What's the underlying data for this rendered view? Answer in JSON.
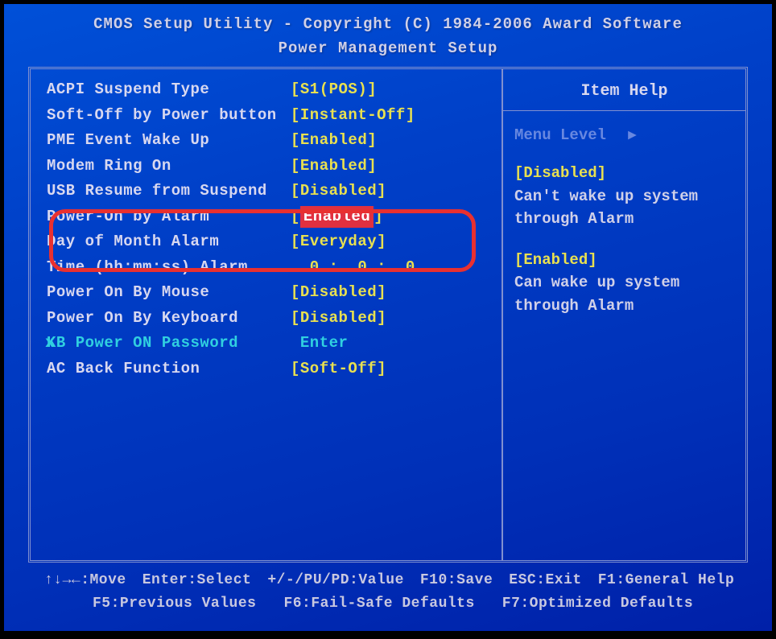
{
  "header": {
    "title_line1": "CMOS Setup Utility - Copyright (C) 1984-2006 Award Software",
    "title_line2": "Power Management Setup"
  },
  "settings": [
    {
      "label": "ACPI Suspend Type",
      "value": "[S1(POS)]",
      "highlighted": false,
      "disabled": false
    },
    {
      "label": "Soft-Off by Power button",
      "value": "[Instant-Off]",
      "highlighted": false,
      "disabled": false
    },
    {
      "label": "PME Event Wake Up",
      "value": "[Enabled]",
      "highlighted": false,
      "disabled": false
    },
    {
      "label": "Modem Ring On",
      "value": "[Enabled]",
      "highlighted": false,
      "disabled": false
    },
    {
      "label": "USB Resume from Suspend",
      "value": "[Disabled]",
      "highlighted": false,
      "disabled": false
    },
    {
      "label": "Power-On by Alarm",
      "value": "Enabled",
      "highlighted": true,
      "disabled": false,
      "prefix": "[",
      "suffix": "]"
    },
    {
      "label": "Day of Month Alarm",
      "value": "[Everyday]",
      "highlighted": false,
      "disabled": false
    },
    {
      "label": "Time (hh:mm:ss) Alarm",
      "value": "  0 :  0 :  0",
      "highlighted": false,
      "disabled": false
    },
    {
      "label": "Power On By Mouse",
      "value": "[Disabled]",
      "highlighted": false,
      "disabled": false
    },
    {
      "label": "Power On By Keyboard",
      "value": "[Disabled]",
      "highlighted": false,
      "disabled": false
    },
    {
      "label": "KB Power ON Password",
      "value": " Enter",
      "highlighted": false,
      "disabled": true,
      "xmark": true
    },
    {
      "label": "AC Back Function",
      "value": "[Soft-Off]",
      "highlighted": false,
      "disabled": false
    }
  ],
  "help": {
    "title": "Item Help",
    "menu_level": "Menu Level",
    "sections": [
      {
        "heading": "[Disabled]",
        "text": "Can't wake up system through Alarm"
      },
      {
        "heading": "[Enabled]",
        "text": "Can wake up system through Alarm"
      }
    ]
  },
  "footer": {
    "row1": [
      "↑↓→←:Move",
      "Enter:Select",
      "+/-/PU/PD:Value",
      "F10:Save",
      "ESC:Exit",
      "F1:General Help"
    ],
    "row2": [
      "F5:Previous Values",
      "F6:Fail-Safe Defaults",
      "F7:Optimized Defaults"
    ]
  }
}
